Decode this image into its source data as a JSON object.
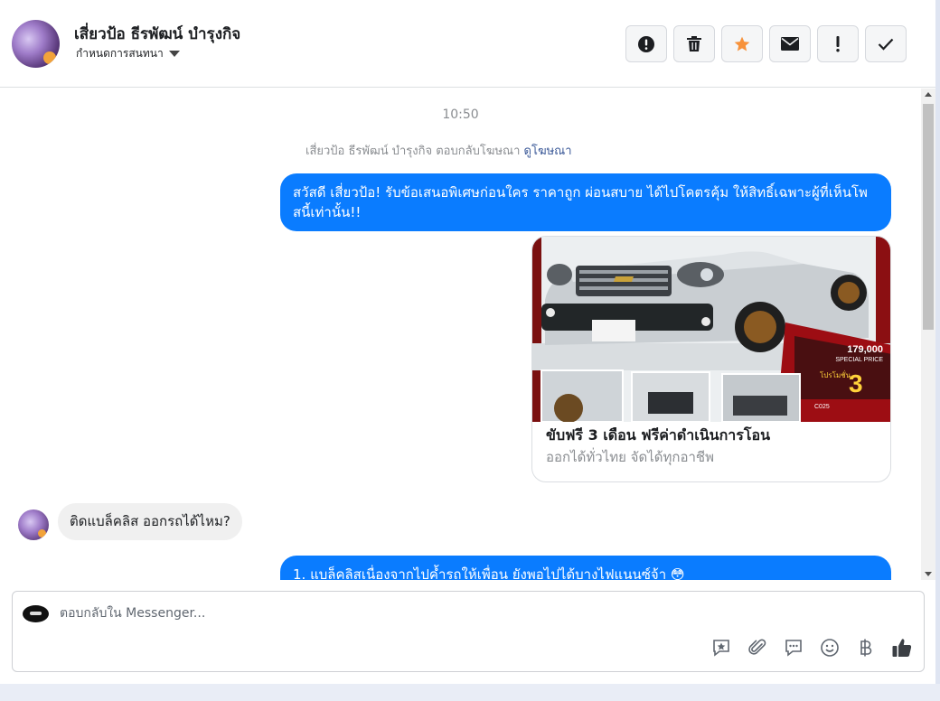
{
  "header": {
    "contact_name": "เสี่ยวป้อ ธีรพัฒน์ บำรุงกิจ",
    "label_dropdown": "กำหนดการสนทนา",
    "toolbar": [
      {
        "name": "report-spam",
        "icon": "alert-circle-icon"
      },
      {
        "name": "delete",
        "icon": "trash-icon"
      },
      {
        "name": "star",
        "icon": "star-icon",
        "color": "#f7923b"
      },
      {
        "name": "mark-unread",
        "icon": "envelope-icon"
      },
      {
        "name": "follow-up",
        "icon": "exclamation-icon"
      },
      {
        "name": "mark-done",
        "icon": "check-icon"
      }
    ]
  },
  "conversation": {
    "timestamp": "10:50",
    "ad_reply_text": "เสี่ยวป้อ ธีรพัฒน์ บำรุงกิจ ตอบกลับโฆษณา",
    "ad_reply_link": "ดูโฆษณา",
    "messages": [
      {
        "direction": "outgoing",
        "text": "สวัสดี เสี่ยวป้อ! รับข้อเสนอพิเศษก่อนใคร ราคาถูก ผ่อนสบาย ได้ไปโคตรคุ้ม ให้สิทธิ์เฉพาะผู้ที่เห็นโพสนี้เท่านั้น!!"
      },
      {
        "direction": "outgoing",
        "type": "ad-card",
        "title": "ขับฟรี 3 เดือน ฟรีค่าดำเนินการโอน",
        "subtitle": "ออกได้ทั่วไทย จัดได้ทุกอาชีพ",
        "image_price": "179,000",
        "image_price_label": "SPECIAL PRICE",
        "image_promo": "โปรโมชั่น",
        "image_promo_big": "3",
        "image_code": "C025"
      },
      {
        "direction": "incoming",
        "text": "ติดแบล็คลิส ออกรถได้ไหม?"
      },
      {
        "direction": "outgoing",
        "text": "1. แบล็คลิสเนื่องจากไปค้ำรถให้เพื่อน ยังพอไปได้บางไฟแนนซ์จ้า 😳"
      }
    ]
  },
  "composer": {
    "placeholder": "ตอบกลับใน Messenger...",
    "tools": [
      "saved-reply-icon",
      "attachment-icon",
      "chat-bubbles-icon",
      "emoji-icon",
      "baht-icon",
      "thumbs-up-icon"
    ]
  },
  "colors": {
    "outgoing_bubble": "#0a7cff",
    "incoming_bubble": "#f0f0f0",
    "link": "#3b5998"
  }
}
